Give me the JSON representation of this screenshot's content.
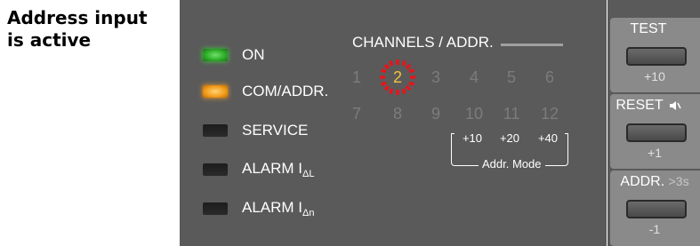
{
  "caption": {
    "line1": "Address input",
    "line2": "is active"
  },
  "status_leds": [
    {
      "label": "ON",
      "state": "green"
    },
    {
      "label": "COM/ADDR.",
      "state": "orange"
    },
    {
      "label": "SERVICE",
      "state": "off"
    },
    {
      "label": "ALARM I",
      "sub": "ΔL",
      "state": "off"
    },
    {
      "label": "ALARM I",
      "sub": "Δn",
      "state": "off"
    }
  ],
  "channels": {
    "header": "CHANNELS / ADDR.",
    "row1": [
      "1",
      "2",
      "3",
      "4",
      "5",
      "6"
    ],
    "row2": [
      "7",
      "8",
      "9",
      "10",
      "11",
      "12"
    ],
    "active": "2"
  },
  "addr_mode": {
    "offsets": [
      "+10",
      "+20",
      "+40"
    ],
    "label": "Addr. Mode"
  },
  "buttons": {
    "test": {
      "label": "TEST",
      "sub": "+10"
    },
    "reset": {
      "label": "RESET",
      "sub": "+1"
    },
    "addr": {
      "label": "ADDR.",
      "hint": ">3s",
      "sub": "-1"
    }
  },
  "colors": {
    "panel": "#5a5a5a",
    "side": "#8a8a8a",
    "active_channel": "#f0c23c",
    "blink": "#e8141c"
  }
}
